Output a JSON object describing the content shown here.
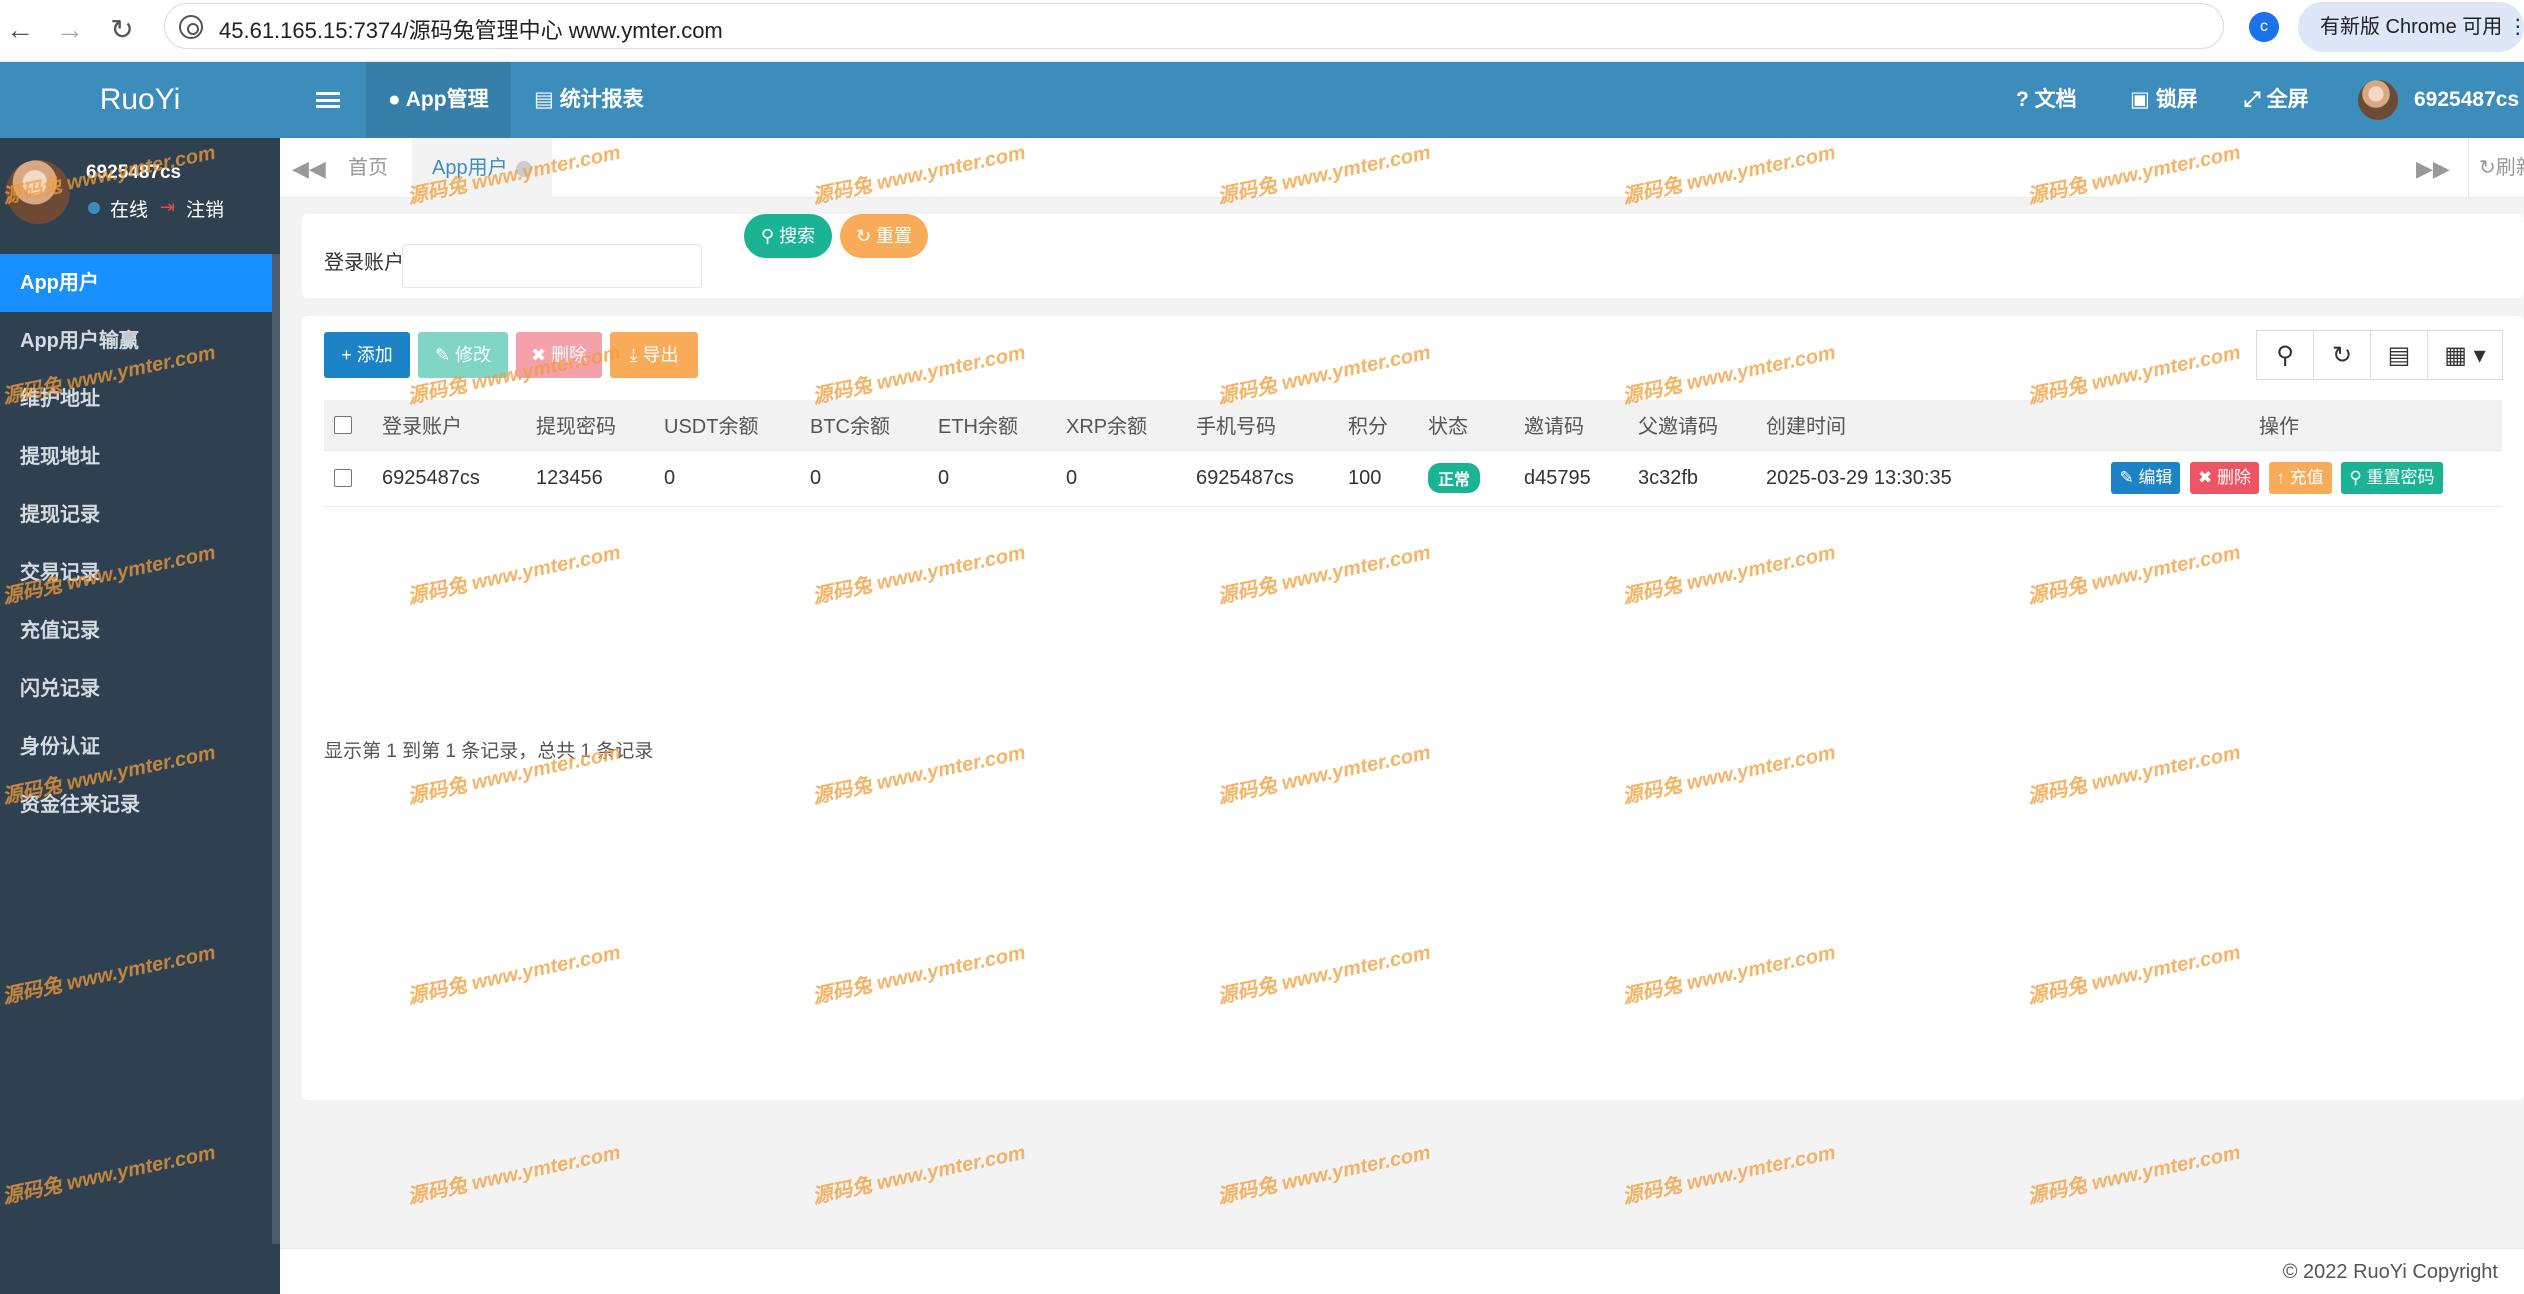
{
  "browser": {
    "back_icon": "←",
    "forward_icon": "→",
    "reload_icon": "↻",
    "url": "45.61.165.15:7374/源码兔管理中心  www.ymter.com",
    "extension_letter": "c",
    "update_label": "有新版 Chrome 可用 ⋮"
  },
  "sidebar": {
    "logo": "RuoYi",
    "user_name": "6925487cs",
    "status": "在线",
    "logout": "注销",
    "items": [
      {
        "label": "App用户"
      },
      {
        "label": "App用户输赢"
      },
      {
        "label": "维护地址"
      },
      {
        "label": "提现地址"
      },
      {
        "label": "提现记录"
      },
      {
        "label": "交易记录"
      },
      {
        "label": "充值记录"
      },
      {
        "label": "闪兑记录"
      },
      {
        "label": "身份认证"
      },
      {
        "label": "资金往来记录"
      }
    ]
  },
  "header": {
    "tabs": [
      "App管理",
      "统计报表"
    ],
    "docs": "文档",
    "lock": "锁屏",
    "fullscreen": "全屏",
    "user": "6925487cs"
  },
  "page_tabs": {
    "home": "首页",
    "current": "App用户",
    "refresh": "刷新"
  },
  "search": {
    "label": "登录账户：",
    "value": "",
    "search_btn": "搜索",
    "reset_btn": "重置"
  },
  "toolbar": {
    "add": "添加",
    "edit": "修改",
    "delete": "删除",
    "export": "导出"
  },
  "table": {
    "columns": [
      "登录账户",
      "提现密码",
      "USDT余额",
      "BTC余额",
      "ETH余额",
      "XRP余额",
      "手机号码",
      "积分",
      "状态",
      "邀请码",
      "父邀请码",
      "创建时间",
      "操作"
    ],
    "rows": [
      {
        "account": "6925487cs",
        "withdraw_pwd": "123456",
        "usdt": "0",
        "btc": "0",
        "eth": "0",
        "xrp": "0",
        "phone": "6925487cs",
        "points": "100",
        "status": "正常",
        "invite": "d45795",
        "parent_invite": "3c32fb",
        "created": "2025-03-29 13:30:35"
      }
    ],
    "actions": {
      "edit": "编辑",
      "delete": "删除",
      "recharge": "充值",
      "reset_pwd": "重置密码"
    }
  },
  "pager_text": "显示第 1 到第 1 条记录，总共 1 条记录",
  "footer": "© 2022 RuoYi Copyright",
  "watermark": "源码兔 www.ymter.com",
  "colors": {
    "header": "#3c8dbc",
    "sidebar": "#2f4050",
    "active_menu": "#1890ff",
    "primary": "#1c84c6",
    "success": "#1ab394",
    "danger": "#ed5565",
    "warning": "#f8ac59"
  }
}
